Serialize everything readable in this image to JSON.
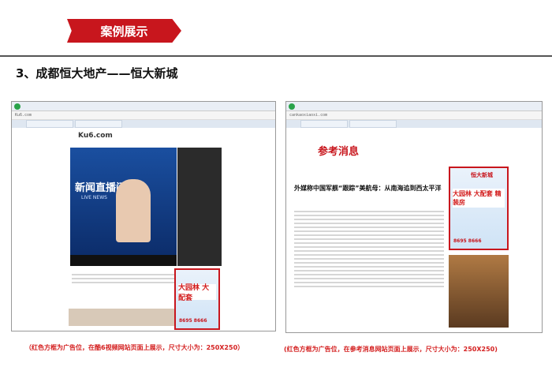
{
  "banner": {
    "title": "案例展示"
  },
  "heading": "3、成都恒大地产——恒大新城",
  "shots": [
    {
      "site": "Ku6.com",
      "video_title": "新闻直播间",
      "video_sub": "LIVE NEWS",
      "ad_text": "大园林 大配套",
      "ad_phone": "8695 8666"
    },
    {
      "site": "参考消息",
      "site_url": "cankaoxiaoxi.com",
      "headline": "外媒称中国军舰“跟踪”美航母：从南海追到西太平洋",
      "ad_brand": "恒大新城",
      "ad_text": "大园林 大配套 精装房",
      "ad_phone": "8695 8666"
    }
  ],
  "captions": [
    "（红色方框为广告位，在酷6视频网站页面上展示，尺寸大小为：250X250）",
    "(红色方框为广告位，在参考消息网站页面上展示，尺寸大小为：250X250)"
  ],
  "colors": {
    "accent": "#c8161d"
  }
}
